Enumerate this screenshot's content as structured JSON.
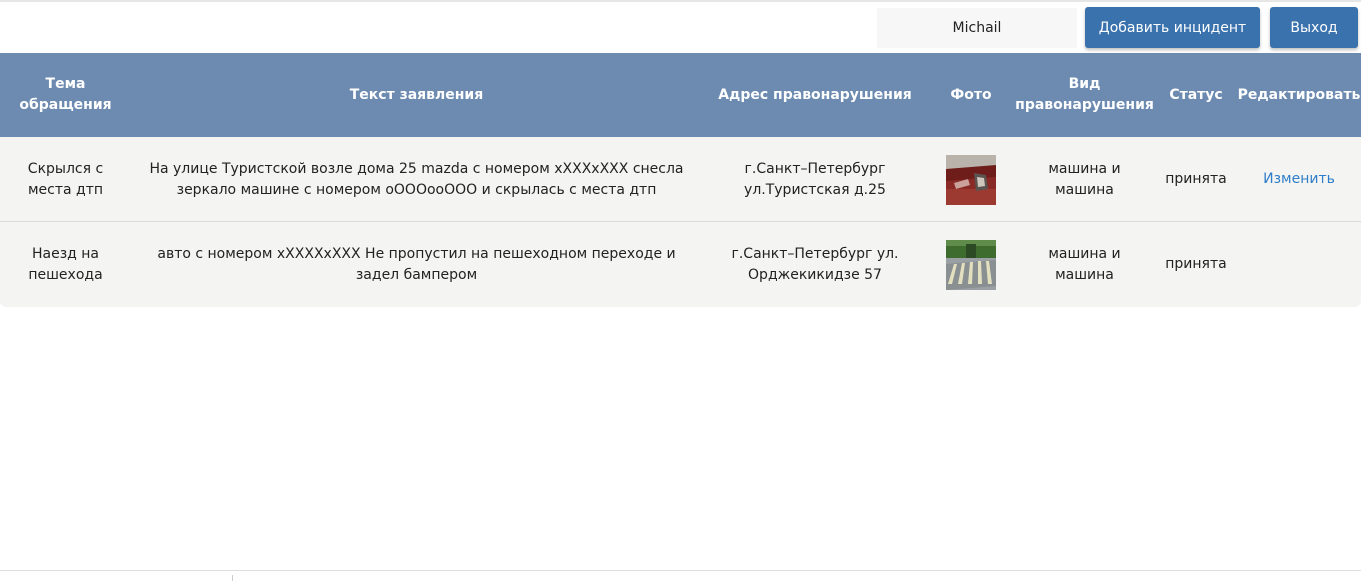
{
  "header": {
    "user_name": "Michail",
    "add_incident_label": "Добавить инцидент",
    "exit_label": "Выход"
  },
  "table": {
    "columns": [
      "Тема обращения",
      "Текст заявления",
      "Адрес правонарушения",
      "Фото",
      "Вид правонарушения",
      "Статус",
      "Редактировать"
    ],
    "rows": [
      {
        "topic": "Скрылся с места дтп",
        "text": "На улице Туристской возле дома 25 mazda с номером хXXXхХХХ снесла зеркало машине с номером оOOOооООО и скрылась с места дтп",
        "address": "г.Санкт–Петербург ул.Туристская д.25",
        "photo_icon": "car-side-mirror-photo",
        "violation_type": "машина и машина",
        "status": "принята",
        "edit_label": "Изменить"
      },
      {
        "topic": "Наезд на пешехода",
        "text": "авто с номером хXXXXхXXX Не пропустил на пешеходном переходе и задел бампером",
        "address": "г.Санкт–Петербург ул. Орджекикидзе 57",
        "photo_icon": "crosswalk-photo",
        "violation_type": "машина и машина",
        "status": "принята",
        "edit_label": ""
      }
    ]
  },
  "colors": {
    "header_bg": "#6d8bb0",
    "button_bg": "#3a72ad",
    "link": "#2f7ec9",
    "table_bg": "#f4f4f2"
  }
}
